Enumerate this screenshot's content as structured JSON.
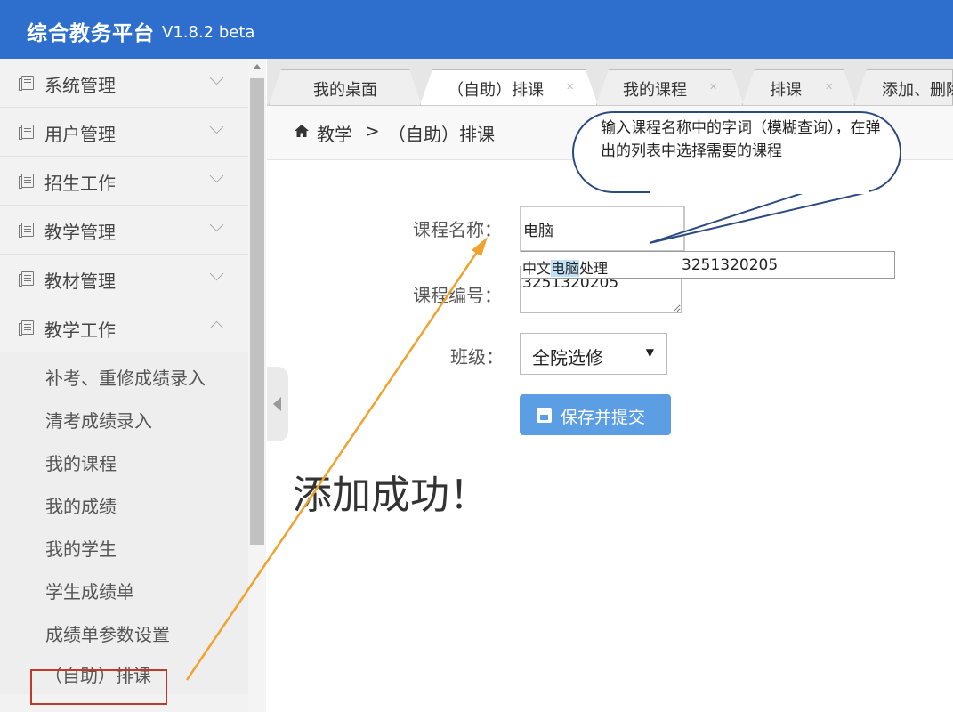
{
  "header": {
    "title": "综合教务平台",
    "version": "V1.8.2 beta"
  },
  "sidebar": {
    "menus": [
      {
        "label": "系统管理",
        "expanded": false
      },
      {
        "label": "用户管理",
        "expanded": false
      },
      {
        "label": "招生工作",
        "expanded": false
      },
      {
        "label": "教学管理",
        "expanded": false
      },
      {
        "label": "教材管理",
        "expanded": false
      },
      {
        "label": "教学工作",
        "expanded": true
      }
    ],
    "submenu": [
      "补考、重修成绩录入",
      "清考成绩录入",
      "我的课程",
      "我的成绩",
      "我的学生",
      "学生成绩单",
      "成绩单参数设置",
      "（自助）排课"
    ],
    "active_item": "（自助）排课"
  },
  "tabs": [
    {
      "label": "我的桌面",
      "active": false,
      "closable": false
    },
    {
      "label": "（自助）排课",
      "active": true,
      "closable": true
    },
    {
      "label": "我的课程",
      "active": false,
      "closable": true
    },
    {
      "label": "排课",
      "active": false,
      "closable": true
    },
    {
      "label": "添加、删除",
      "active": false,
      "closable": false
    }
  ],
  "breadcrumb": {
    "root": "教学",
    "separator": ">",
    "current": "（自助）排课"
  },
  "form": {
    "course_name_label": "课程名称：",
    "course_name_value": "电脑",
    "course_code_label": "课程编号：",
    "course_code_value": "3251320205",
    "class_label": "班级：",
    "class_value": "全院选修",
    "submit_label": "保存并提交"
  },
  "suggestion": {
    "name_before": "中文",
    "name_match": "电脑",
    "name_after": "处理",
    "code": "3251320205"
  },
  "success_message": "添加成功！",
  "callout": {
    "text": "输入课程名称中的字词（模糊查询），在弹出的列表中选择需要的课程"
  },
  "colors": {
    "header_bg": "#2e6fcd",
    "button_bg": "#5b9ee4",
    "highlight": "#bfe1f7",
    "active_box": "#c0392b",
    "arrow": "#f0a22e"
  }
}
